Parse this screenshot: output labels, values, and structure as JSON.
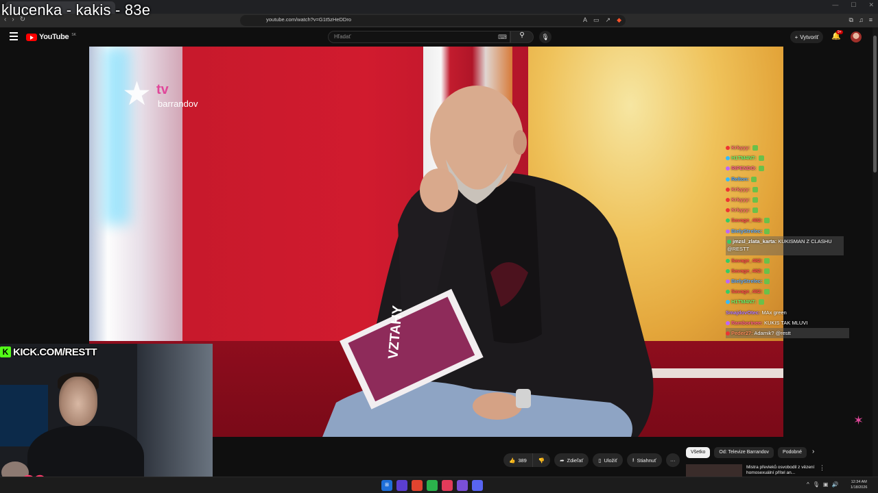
{
  "overlay": {
    "title": "klucenka - kakis - 83e"
  },
  "browser": {
    "url": "youtube.com/watch?v=G1t5zHeDDro",
    "colors": {
      "chrome": "#202124",
      "address": "#2b2b2b"
    }
  },
  "youtube": {
    "logo_text": "YouTube",
    "region": "SK",
    "search_placeholder": "Hľadať",
    "create_label": "Vytvoriť",
    "notifications_badge": "9+",
    "brand_color": "#ff0000"
  },
  "video": {
    "channel_logo": {
      "word": "tv",
      "name": "barrandov"
    },
    "booklet_text": "VZTAHY"
  },
  "chat": [
    {
      "user": "Krkyyy:",
      "msg": "",
      "color": "#ff6b6b",
      "dot": "#e33"
    },
    {
      "user": "H1TM4N7:",
      "msg": "",
      "color": "#6cf56c",
      "dot": "#3bf"
    },
    {
      "user": "RIPENDO:",
      "msg": "",
      "color": "#ff5c8a",
      "dot": "#b6f"
    },
    {
      "user": "Relton:",
      "msg": "",
      "color": "#4aa3ff",
      "dot": "#3bf"
    },
    {
      "user": "Krkyyy:",
      "msg": "",
      "color": "#ff6b6b",
      "dot": "#e33"
    },
    {
      "user": "Krkyyy:",
      "msg": "",
      "color": "#ff6b6b",
      "dot": "#e33"
    },
    {
      "user": "Krkyyy:",
      "msg": "",
      "color": "#ff6b6b",
      "dot": "#e33"
    },
    {
      "user": "Savage_482:",
      "msg": "",
      "color": "#ff4a4a",
      "dot": "#3c6"
    },
    {
      "user": "BielyStrelec:",
      "msg": "",
      "color": "#5aa8ff",
      "dot": "#b6f"
    },
    {
      "user": "jmzsl_zlata_karta:",
      "msg": "KUKISMAN Z CLASHU @RESTT",
      "color": "#ffffff",
      "dot": "#3c6",
      "highlight": true,
      "tall": true
    },
    {
      "user": "Savage_482:",
      "msg": "",
      "color": "#ff4a4a",
      "dot": "#3c6"
    },
    {
      "user": "Savage_482:",
      "msg": "",
      "color": "#ff4a4a",
      "dot": "#3c6"
    },
    {
      "user": "BielyStrelec:",
      "msg": "",
      "color": "#5aa8ff",
      "dot": "#b6f"
    },
    {
      "user": "Savage_482:",
      "msg": "",
      "color": "#ff4a4a",
      "dot": "#3c6"
    },
    {
      "user": "H1TM4N7:",
      "msg": "",
      "color": "#6cf56c",
      "dot": "#3bf"
    },
    {
      "user": "SmajdovOtec:",
      "msg": "MAx green",
      "color": "#b57bff",
      "dot": ""
    },
    {
      "user": "Ramborinee:",
      "msg": "KUKIS TAK MLUVI",
      "color": "#ff5c8a",
      "dot": "#b6f"
    },
    {
      "user": "Peder27:",
      "msg": "Adamik? @restt",
      "color": "#ff8c5a",
      "dot": "#e33",
      "highlight": true
    }
  ],
  "webcam": {
    "banner": "KICK.COM/RESTT",
    "banner_color": "#53fc18"
  },
  "actions": {
    "likes": "389",
    "share": "Zdieľať",
    "save": "Uložiť",
    "download": "Stiahnuť"
  },
  "chips": [
    "Všetko",
    "Od: Televize Barrandov",
    "Podobné"
  ],
  "recommendation": {
    "title": "Mistra převleků osvobodil z vězení homosexuální přítel an..."
  },
  "taskbar": {
    "time": "12:34 AM",
    "date": "1/18/2026"
  }
}
